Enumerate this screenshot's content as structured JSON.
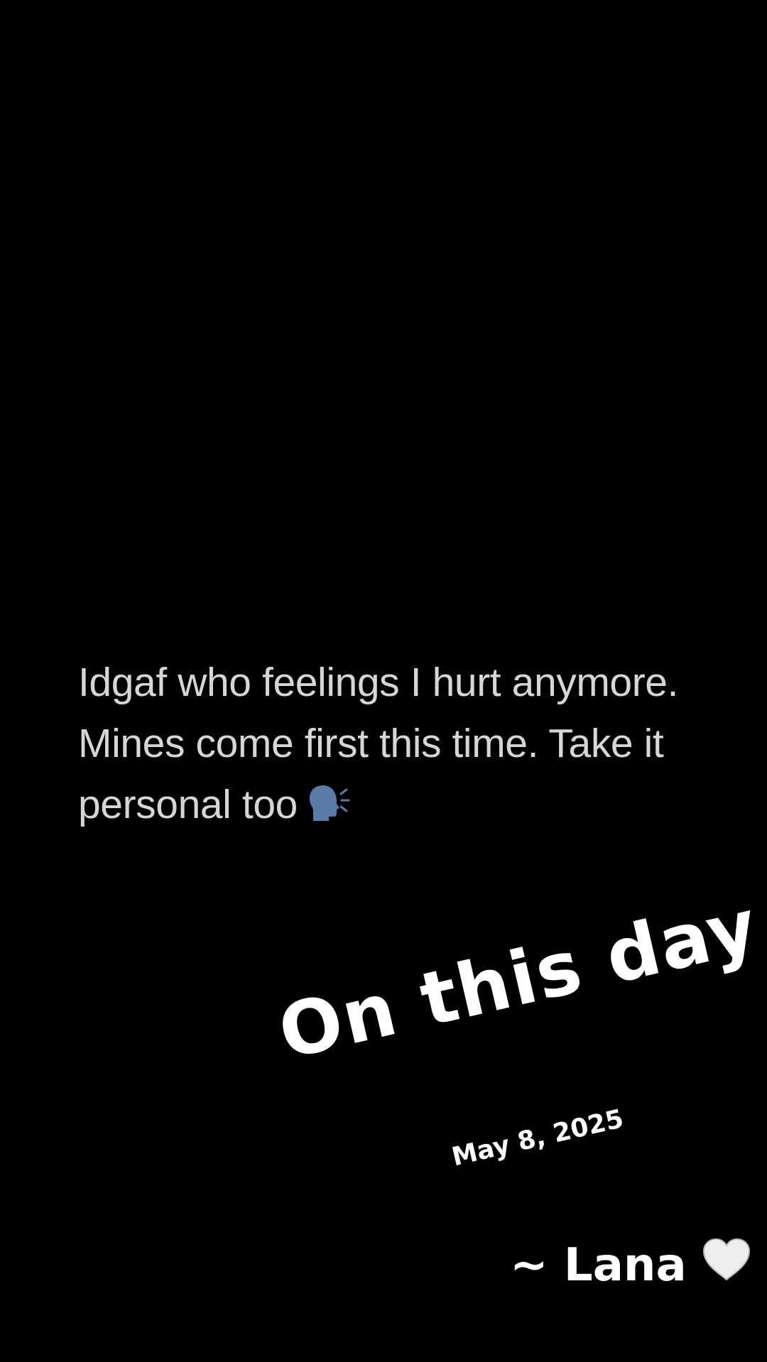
{
  "quote": {
    "lines": [
      "Idgaf who feelings I hurt anymore.",
      "Mines come first this time. Take it",
      "personal too"
    ],
    "emoji_icon": "speaking-head-icon"
  },
  "sticker": {
    "title": "On this day",
    "date": "May 8, 2025"
  },
  "signature": {
    "text": "~ Lana",
    "heart_icon": "white-heart-icon"
  },
  "colors": {
    "background": "#000000",
    "quote_text": "#d6d6d6",
    "sticker_text": "#ffffff",
    "emoji": "#5a7ba6"
  }
}
